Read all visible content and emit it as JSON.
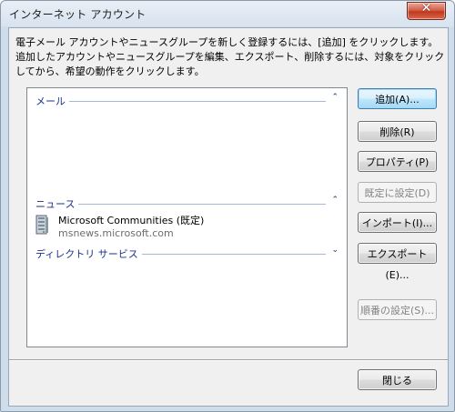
{
  "window": {
    "title": "インターネット アカウント",
    "close_glyph": "✕"
  },
  "description": "電子メール アカウントやニュースグループを新しく登録するには、[追加] をクリックします。追加したアカウントやニュースグループを編集、エクスポート、削除するには、対象をクリックしてから、希望の動作をクリックします。",
  "list": {
    "groups": [
      {
        "label": "メール",
        "chevron": "⌃"
      },
      {
        "label": "ニュース",
        "chevron": "⌃"
      },
      {
        "label": "ディレクトリ サービス",
        "chevron": "⌄"
      }
    ],
    "news_account": {
      "name": "Microsoft Communities (既定)",
      "server": "msnews.microsoft.com",
      "icon": "server-icon"
    }
  },
  "buttons": {
    "add": "追加(A)...",
    "remove": "削除(R)",
    "properties": "プロパティ(P)",
    "set_default": "既定に設定(D)",
    "import": "インポート(I)...",
    "export": "エクスポート(E)...",
    "set_order": "順番の設定(S)...",
    "close": "閉じる"
  },
  "colors": {
    "group_header": "#1e3287",
    "default_button_border": "#3c7fb1"
  }
}
